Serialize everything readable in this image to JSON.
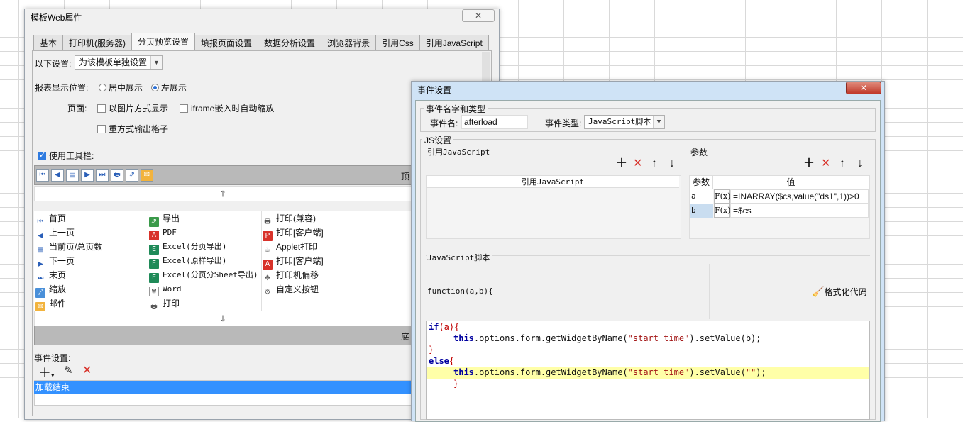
{
  "main_window": {
    "title": "模板Web属性",
    "close_label": "✕",
    "tabs": [
      {
        "label": "基本"
      },
      {
        "label": "打印机(服务器)"
      },
      {
        "label": "分页预览设置"
      },
      {
        "label": "填报页面设置"
      },
      {
        "label": "数据分析设置"
      },
      {
        "label": "浏览器背景"
      },
      {
        "label": "引用Css"
      },
      {
        "label": "引用JavaScript"
      }
    ],
    "settings_label": "以下设置:",
    "settings_value": "为该模板单独设置",
    "position_label": "报表显示位置:",
    "position_center": "居中展示",
    "position_left": "左展示",
    "page_label": "页面:",
    "opt_image": "以图片方式显示",
    "opt_iframe": "iframe嵌入时自动缩放",
    "opt_repeat": "重方式输出格子",
    "use_toolbar": "使用工具栏:",
    "top_label": "顶",
    "bottom_label": "底",
    "items_col1": [
      "首页",
      "上一页",
      "当前页/总页数",
      "下一页",
      "末页",
      "缩放",
      "邮件"
    ],
    "items_col2": [
      "导出",
      "PDF",
      "Excel(分页导出)",
      "Excel(原样导出)",
      "Excel(分页分Sheet导出)",
      "Word",
      "打印"
    ],
    "items_col3": [
      "打印(兼容)",
      "打印[客户端]",
      "Applet打印",
      "打印[客户端]",
      "打印机偏移",
      "自定义按钮"
    ],
    "event_label": "事件设置:",
    "event_item": "加载结束"
  },
  "event_dialog": {
    "title": "事件设置",
    "close_label": "✕",
    "name_group": "事件名字和类型",
    "event_name_label": "事件名:",
    "event_name_value": "afterload",
    "event_type_label": "事件类型:",
    "event_type_value": "JavaScript脚本",
    "js_group": "JS设置",
    "ref_js_label": "引用JavaScript",
    "ref_js_header": "引用JavaScript",
    "params_label": "参数",
    "params_col_param": "参数",
    "params_col_value": "值",
    "params": [
      {
        "name": "a",
        "fx": "F(x)",
        "value": "=INARRAY($cs,value(\"ds1\",1))>0"
      },
      {
        "name": "b",
        "fx": "F(x)",
        "value": "=$cs"
      }
    ],
    "script_label": "JavaScript脚本",
    "function_sig": "function(a,b){",
    "format_btn": "格式化代码",
    "code": {
      "l1a": "if",
      "l1b": "(a){",
      "l2a": "this",
      "l2b": ".options.form.getWidgetByName(",
      "l2c": "\"start_time\"",
      "l2d": ").setValue(b);",
      "l3": "}",
      "l4a": "else",
      "l4b": "{",
      "l5a": "this",
      "l5b": ".options.form.getWidgetByName(",
      "l5c": "\"start_time\"",
      "l5d": ").setValue(",
      "l5e": "\"\"",
      "l5f": ");",
      "l6": "}"
    }
  }
}
